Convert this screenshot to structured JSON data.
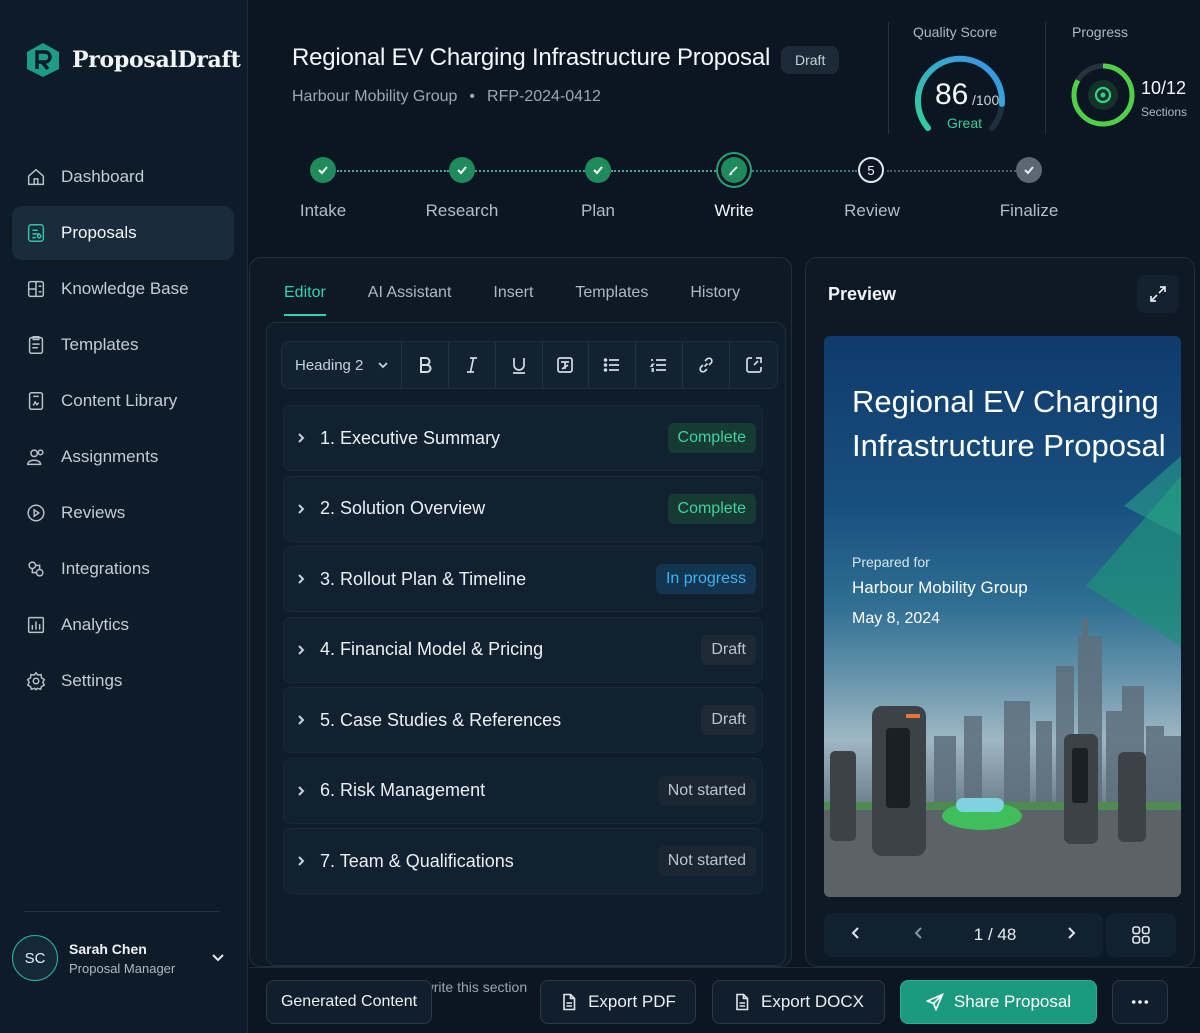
{
  "app": {
    "name": "ProposalDraft"
  },
  "sidebar": {
    "items": [
      {
        "label": "Dashboard",
        "icon": "home-icon"
      },
      {
        "label": "Proposals",
        "icon": "proposal-doc-icon",
        "active": true
      },
      {
        "label": "Knowledge Base",
        "icon": "knowledge-base-icon"
      },
      {
        "label": "Templates",
        "icon": "template-icon"
      },
      {
        "label": "Content Library",
        "icon": "library-icon"
      },
      {
        "label": "Assignments",
        "icon": "users-icon"
      },
      {
        "label": "Reviews",
        "icon": "review-icon"
      },
      {
        "label": "Integrations",
        "icon": "integrations-icon"
      },
      {
        "label": "Analytics",
        "icon": "analytics-icon"
      },
      {
        "label": "Settings",
        "icon": "gear-icon"
      }
    ],
    "user": {
      "initials": "SC",
      "name": "Sarah Chen",
      "role": "Proposal Manager"
    }
  },
  "header": {
    "title": "Regional EV Charging Infrastructure Proposal",
    "status": "Draft",
    "client": "Harbour Mobility Group",
    "separator": "•",
    "rfp": "RFP-2024-0412",
    "quality": {
      "label": "Quality Score",
      "score": "86",
      "max": "/100",
      "rating": "Great",
      "fraction": 0.86
    },
    "progress": {
      "label": "Progress",
      "count": "10/12",
      "unit": "Sections",
      "fraction": 0.833
    }
  },
  "stepper": {
    "steps": [
      {
        "label": "Intake",
        "state": "done"
      },
      {
        "label": "Research",
        "state": "done"
      },
      {
        "label": "Plan",
        "state": "done"
      },
      {
        "label": "Write",
        "state": "current"
      },
      {
        "label": "Review",
        "state": "upcoming",
        "number": "5"
      },
      {
        "label": "Finalize",
        "state": "final"
      }
    ]
  },
  "editor": {
    "tabs": [
      "Editor",
      "AI Assistant",
      "Insert",
      "Templates",
      "History"
    ],
    "heading_select": "Heading 2",
    "sections": [
      {
        "title": "1. Executive Summary",
        "status": "Complete",
        "kind": "complete"
      },
      {
        "title": "2. Solution Overview",
        "status": "Complete",
        "kind": "complete"
      },
      {
        "title": "3. Rollout Plan & Timeline",
        "status": "In progress",
        "kind": "inprogress"
      },
      {
        "title": "4. Financial Model & Pricing",
        "status": "Draft",
        "kind": "draft"
      },
      {
        "title": "5. Case Studies & References",
        "status": "Draft",
        "kind": "draft"
      },
      {
        "title": "6. Risk Management",
        "status": "Not started",
        "kind": "notstarted"
      },
      {
        "title": "7. Team & Qualifications",
        "status": "Not started",
        "kind": "notstarted"
      }
    ],
    "ai_hint": "AI is helping you write this section"
  },
  "preview": {
    "title": "Preview",
    "cover": {
      "title": "Regional EV Charging Infrastructure Proposal",
      "prepared_for": "Prepared for",
      "client": "Harbour Mobility Group",
      "date": "May 8, 2024"
    },
    "page": "1 / 48"
  },
  "footer": {
    "generated": "Generated Content",
    "export_pdf": "Export PDF",
    "export_docx": "Export DOCX",
    "share": "Share Proposal"
  },
  "colors": {
    "accent": "#36d1b0",
    "complete": "#3dd39c",
    "inprogress": "#3fb2f0",
    "background": "#0b1622"
  }
}
